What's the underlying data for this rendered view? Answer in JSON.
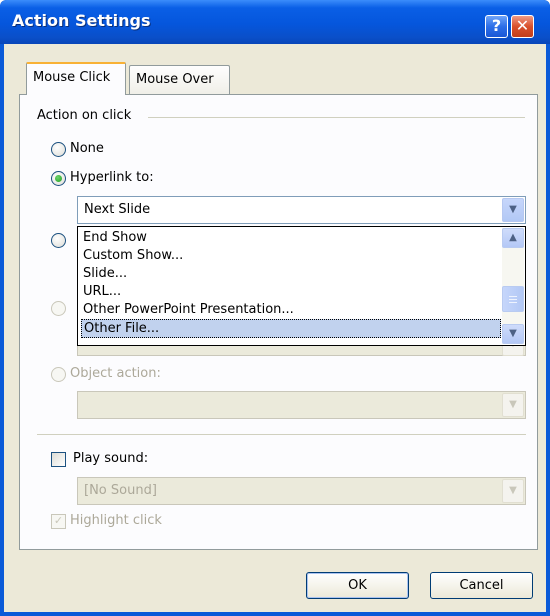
{
  "window": {
    "title": "Action Settings",
    "help_label": "?",
    "close_label": "✕"
  },
  "tabs": [
    {
      "label": "Mouse Click",
      "selected": true
    },
    {
      "label": "Mouse Over",
      "selected": false
    }
  ],
  "group": {
    "label": "Action on click"
  },
  "options": {
    "none": {
      "label": "None",
      "selected": false,
      "enabled": true
    },
    "hyperlink": {
      "label": "Hyperlink to:",
      "selected": true,
      "enabled": true
    },
    "run_program": {
      "selected": false,
      "enabled": true
    },
    "run_macro": {
      "selected": false,
      "enabled": false
    },
    "object_action": {
      "label": "Object action:",
      "selected": false,
      "enabled": false
    }
  },
  "hyperlink_combo": {
    "value": "Next Slide",
    "dropdown_items": [
      "End Show",
      "Custom Show...",
      "Slide...",
      "URL...",
      "Other PowerPoint Presentation...",
      "Other File..."
    ],
    "highlighted_index": 5
  },
  "sound": {
    "checkbox_label": "Play sound:",
    "checked": false,
    "value": "[No Sound]"
  },
  "highlight": {
    "label": "Highlight click",
    "checked": true,
    "enabled": false
  },
  "buttons": {
    "ok": "OK",
    "cancel": "Cancel"
  },
  "icons": {
    "dropdown": "chevron-down-icon",
    "scroll_up": "chevron-up-icon",
    "scroll_down": "chevron-down-icon",
    "help": "question-mark-icon",
    "close": "close-icon"
  },
  "colors": {
    "title_bar": "#0556dc",
    "dialog_bg": "#ece9d8",
    "selection": "#c1d2ee"
  }
}
